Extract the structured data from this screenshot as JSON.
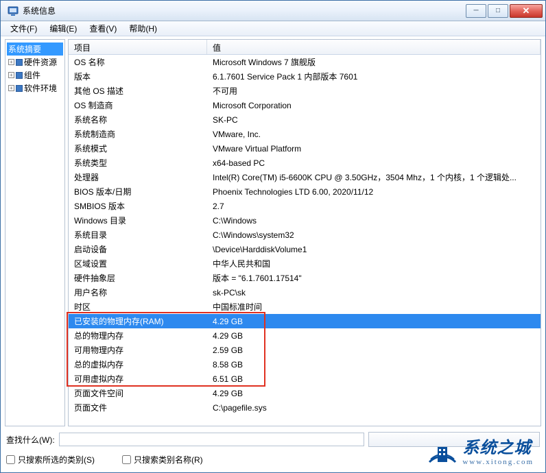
{
  "window": {
    "title": "系统信息"
  },
  "menubar": [
    "文件(F)",
    "编辑(E)",
    "查看(V)",
    "帮助(H)"
  ],
  "tree": {
    "root": "系统摘要",
    "children": [
      "硬件资源",
      "组件",
      "软件环境"
    ]
  },
  "columns": {
    "item": "项目",
    "value": "值"
  },
  "rows": [
    {
      "k": "OS 名称",
      "v": "Microsoft Windows 7 旗舰版"
    },
    {
      "k": "版本",
      "v": "6.1.7601 Service Pack 1 内部版本 7601"
    },
    {
      "k": "其他 OS 描述",
      "v": "不可用"
    },
    {
      "k": "OS 制造商",
      "v": "Microsoft Corporation"
    },
    {
      "k": "系统名称",
      "v": "SK-PC"
    },
    {
      "k": "系统制造商",
      "v": "VMware, Inc."
    },
    {
      "k": "系统模式",
      "v": "VMware Virtual Platform"
    },
    {
      "k": "系统类型",
      "v": "x64-based PC"
    },
    {
      "k": "处理器",
      "v": "Intel(R) Core(TM) i5-6600K CPU @ 3.50GHz，3504 Mhz，1 个内核，1 个逻辑处..."
    },
    {
      "k": "BIOS 版本/日期",
      "v": "Phoenix Technologies LTD 6.00, 2020/11/12"
    },
    {
      "k": "SMBIOS 版本",
      "v": "2.7"
    },
    {
      "k": "Windows 目录",
      "v": "C:\\Windows"
    },
    {
      "k": "系统目录",
      "v": "C:\\Windows\\system32"
    },
    {
      "k": "启动设备",
      "v": "\\Device\\HarddiskVolume1"
    },
    {
      "k": "区域设置",
      "v": "中华人民共和国"
    },
    {
      "k": "硬件抽象层",
      "v": "版本 = \"6.1.7601.17514\""
    },
    {
      "k": "用户名称",
      "v": "sk-PC\\sk"
    },
    {
      "k": "时区",
      "v": "中国标准时间"
    },
    {
      "k": "已安装的物理内存(RAM)",
      "v": "4.29 GB",
      "selected": true
    },
    {
      "k": "总的物理内存",
      "v": "4.29 GB"
    },
    {
      "k": "可用物理内存",
      "v": "2.59 GB"
    },
    {
      "k": "总的虚拟内存",
      "v": "8.58 GB"
    },
    {
      "k": "可用虚拟内存",
      "v": "6.51 GB"
    },
    {
      "k": "页面文件空间",
      "v": "4.29 GB"
    },
    {
      "k": "页面文件",
      "v": "C:\\pagefile.sys"
    }
  ],
  "search": {
    "label": "查找什么(W):"
  },
  "checks": {
    "c1": "只搜索所选的类别(S)",
    "c2": "只搜索类别名称(R)"
  },
  "watermark": {
    "name": "系统之城",
    "url": "www.xitong.com"
  }
}
